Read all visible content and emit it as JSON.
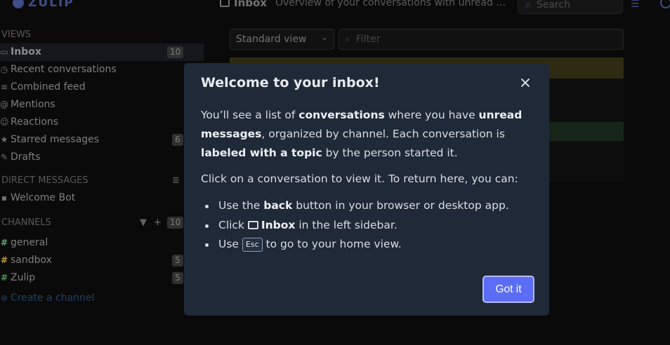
{
  "navbar": {
    "logo_text": "ZULIP",
    "title": "Inbox",
    "description": "Overview of your conversations with unread m...",
    "search_placeholder": "Search"
  },
  "sidebar": {
    "views_heading": "VIEWS",
    "views": [
      {
        "label": "Inbox",
        "icon": "inbox-icon",
        "count": "10"
      },
      {
        "label": "Recent conversations",
        "icon": "clock-icon",
        "count": ""
      },
      {
        "label": "Combined feed",
        "icon": "list-icon",
        "count": ""
      },
      {
        "label": "Mentions",
        "icon": "at-icon",
        "count": ""
      },
      {
        "label": "Reactions",
        "icon": "smile-icon",
        "count": ""
      },
      {
        "label": "Starred messages",
        "icon": "star-icon",
        "count": "6"
      },
      {
        "label": "Drafts",
        "icon": "pencil-icon",
        "count": ""
      }
    ],
    "dm_heading": "DIRECT MESSAGES",
    "dm": [
      {
        "label": "Welcome Bot",
        "icon": "bot-icon"
      }
    ],
    "channels_heading": "CHANNELS",
    "channels_count": "10",
    "channels": [
      {
        "label": "general",
        "color": "#76ce90",
        "count": ""
      },
      {
        "label": "sandbox",
        "color": "#e6c54b",
        "count": "5"
      },
      {
        "label": "Zulip",
        "color": "#6ab06f",
        "count": "5"
      }
    ],
    "create_channel": "Create a channel"
  },
  "inbox": {
    "view_select": "Standard view",
    "filter_placeholder": "Filter"
  },
  "modal": {
    "title": "Welcome to your inbox!",
    "p1_a": "You’ll see a list of ",
    "p1_b": "conversations",
    "p1_c": " where you have ",
    "p1_d": "unread messages",
    "p1_e": ", organized by channel. Each conversation is ",
    "p1_f": "labeled with a topic",
    "p1_g": " by the person started it.",
    "p2": "Click on a conversation to view it. To return here, you can:",
    "b1_a": "Use the ",
    "b1_b": "back",
    "b1_c": " button in your browser or desktop app.",
    "b2_a": "Click ",
    "b2_b": "Inbox",
    "b2_c": " in the left sidebar.",
    "b3_a": "Use ",
    "b3_kbd": "Esc",
    "b3_c": " to go to your home view.",
    "button": "Got it"
  },
  "colors": {
    "modal_bg": "#1f2938",
    "primary_button": "#5b6cf5",
    "brand": "#4c5ea6"
  }
}
